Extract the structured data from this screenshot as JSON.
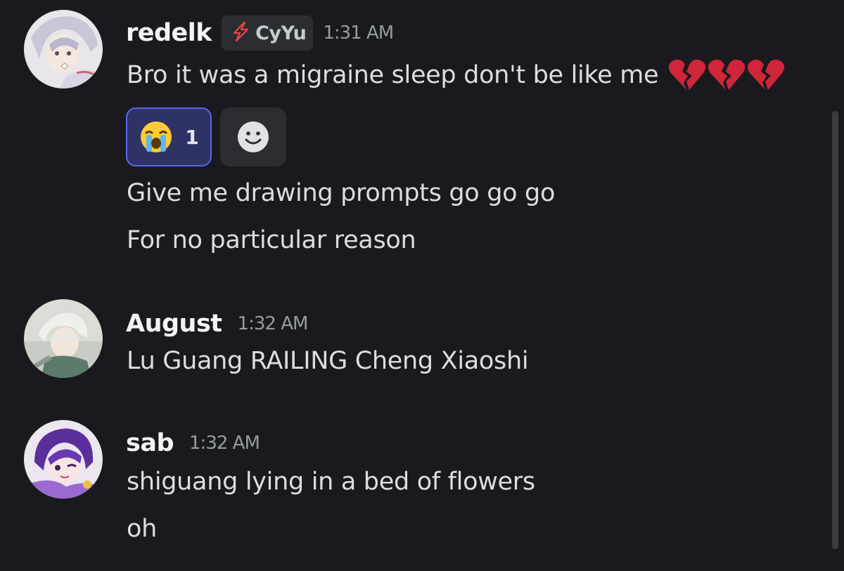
{
  "messages": [
    {
      "author": "redelk",
      "tag": {
        "text": "CyYu",
        "icon": "lightning-bolt-icon",
        "color": "#ed4245"
      },
      "time": "1:31 AM",
      "lines": [
        {
          "text": "Bro it was a migraine sleep don't be like me",
          "emoji": "broken-heart-icon",
          "emoji_count": 3
        }
      ],
      "reactions": [
        {
          "emoji": "loudly-crying-face-icon",
          "count": "1",
          "active": true
        }
      ],
      "add_reaction_icon": "add-reaction-smiley-icon",
      "followups": [
        "Give me drawing prompts go go go",
        "For no particular reason"
      ]
    },
    {
      "author": "August",
      "time": "1:32 AM",
      "lines": [
        "Lu Guang RAILING Cheng Xiaoshi"
      ]
    },
    {
      "author": "sab",
      "time": "1:32 AM",
      "lines": [
        "shiguang lying in a bed of flowers",
        "oh"
      ]
    }
  ],
  "colors": {
    "background": "#1a1a1e",
    "author": "#f2f3f5",
    "message": "#dbdee1",
    "timestamp": "#949ba4",
    "reaction_active_border": "#5865f2",
    "reaction_active_bg": "#2f3264"
  }
}
